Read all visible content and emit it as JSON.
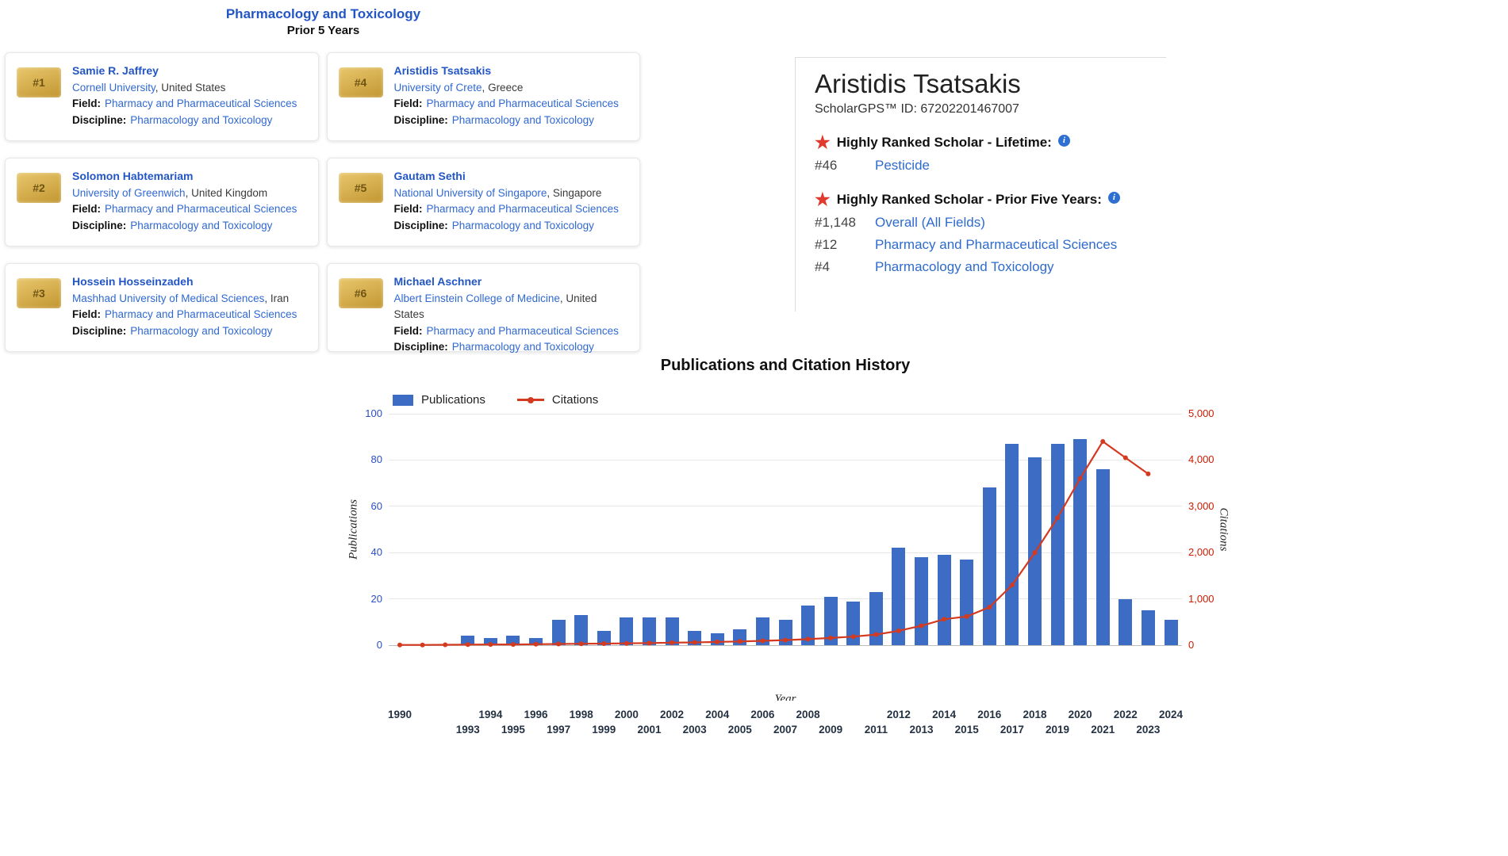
{
  "section": {
    "heading": "Pharmacology and Toxicology",
    "subheading": "Prior 5 Years"
  },
  "labels": {
    "field": "Field:",
    "discipline": "Discipline:"
  },
  "scholars": [
    {
      "rank": "#1",
      "name": "Samie R. Jaffrey",
      "institution": "Cornell University",
      "country": "United States",
      "field": "Pharmacy and Pharmaceutical Sciences",
      "discipline": "Pharmacology and Toxicology"
    },
    {
      "rank": "#2",
      "name": "Solomon Habtemariam",
      "institution": "University of Greenwich",
      "country": "United Kingdom",
      "field": "Pharmacy and Pharmaceutical Sciences",
      "discipline": "Pharmacology and Toxicology"
    },
    {
      "rank": "#3",
      "name": "Hossein Hosseinzadeh",
      "institution": "Mashhad University of Medical Sciences",
      "country": "Iran",
      "field": "Pharmacy and Pharmaceutical Sciences",
      "discipline": "Pharmacology and Toxicology"
    },
    {
      "rank": "#4",
      "name": "Aristidis Tsatsakis",
      "institution": "University of Crete",
      "country": "Greece",
      "field": "Pharmacy and Pharmaceutical Sciences",
      "discipline": "Pharmacology and Toxicology"
    },
    {
      "rank": "#5",
      "name": "Gautam Sethi",
      "institution": "National University of Singapore",
      "country": "Singapore",
      "field": "Pharmacy and Pharmaceutical Sciences",
      "discipline": "Pharmacology and Toxicology"
    },
    {
      "rank": "#6",
      "name": "Michael Aschner",
      "institution": "Albert Einstein College of Medicine",
      "country": "United States",
      "field": "Pharmacy and Pharmaceutical Sciences",
      "discipline": "Pharmacology and Toxicology"
    }
  ],
  "profile": {
    "name": "Aristidis Tsatsakis",
    "scholar_id": "ScholarGPS™ ID: 67202201467007",
    "lifetime_heading": "Highly Ranked Scholar - Lifetime:",
    "lifetime_ranks": [
      {
        "rank": "#46",
        "label": "Pesticide"
      }
    ],
    "prior5_heading": "Highly Ranked Scholar - Prior Five Years:",
    "prior5_ranks": [
      {
        "rank": "#1,148",
        "label": "Overall (All Fields)"
      },
      {
        "rank": "#12",
        "label": "Pharmacy and Pharmaceutical Sciences"
      },
      {
        "rank": "#4",
        "label": "Pharmacology and Toxicology"
      }
    ]
  },
  "chart_data": {
    "type": "bar",
    "title": "Publications and Citation History",
    "xlabel": "Year",
    "ylabel_left": "Publications",
    "ylabel_right": "Citations",
    "legend": [
      "Publications",
      "Citations"
    ],
    "legend_position": "top-left",
    "grid": true,
    "colors": {
      "publications": "#3c6cc4",
      "citations": "#d43a20"
    },
    "ylim_left": [
      0,
      100
    ],
    "ylim_right": [
      0,
      5000
    ],
    "yticks_left": [
      0,
      20,
      40,
      60,
      80,
      100
    ],
    "yticks_right": [
      "0",
      "1,000",
      "2,000",
      "3,000",
      "4,000",
      "5,000"
    ],
    "x_range": [
      1990,
      2024
    ],
    "xticks": [
      1990,
      1993,
      1994,
      1995,
      1996,
      1997,
      1998,
      1999,
      2000,
      2001,
      2002,
      2003,
      2004,
      2005,
      2006,
      2007,
      2008,
      2009,
      2011,
      2012,
      2013,
      2014,
      2015,
      2016,
      2017,
      2018,
      2019,
      2020,
      2021,
      2022,
      2023,
      2024
    ],
    "series": {
      "publications": {
        "name": "Publications",
        "type": "bar",
        "start_year": 1990,
        "values": [
          0,
          0,
          0,
          4,
          3,
          4,
          3,
          11,
          13,
          6,
          12,
          12,
          12,
          6,
          5,
          7,
          12,
          11,
          17,
          21,
          19,
          23,
          42,
          38,
          39,
          37,
          68,
          87,
          81,
          87,
          89,
          76,
          20,
          15,
          11
        ]
      },
      "citations": {
        "name": "Citations",
        "type": "line",
        "start_year": 1990,
        "values": [
          5,
          5,
          8,
          12,
          15,
          15,
          20,
          25,
          30,
          35,
          40,
          45,
          55,
          60,
          70,
          80,
          95,
          110,
          130,
          155,
          185,
          230,
          310,
          420,
          560,
          620,
          820,
          1300,
          2000,
          2750,
          3600,
          4400,
          4050,
          3700
        ]
      }
    }
  }
}
